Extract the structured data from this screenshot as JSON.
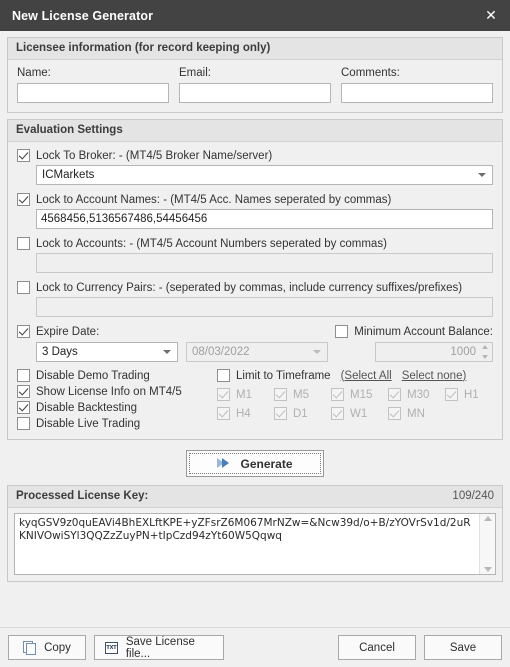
{
  "window": {
    "title": "New License Generator",
    "close_label": "✕"
  },
  "licensee": {
    "group_title": "Licensee information (for record keeping only)",
    "fields": [
      {
        "label": "Name:",
        "value": "",
        "placeholder": ""
      },
      {
        "label": "Email:",
        "value": "",
        "placeholder": ""
      },
      {
        "label": "Comments:",
        "value": "",
        "placeholder": ""
      }
    ]
  },
  "evaluation": {
    "group_title": "Evaluation Settings",
    "lock_broker": {
      "label": "Lock To Broker:  - (MT4/5 Broker Name/server)",
      "checked": true,
      "value": "ICMarkets"
    },
    "lock_account_names": {
      "label": "Lock to Account Names: - (MT4/5 Acc. Names seperated by commas)",
      "checked": true,
      "value": "4568456,5136567486,54456456"
    },
    "lock_accounts": {
      "label": "Lock to Accounts: - (MT4/5 Account Numbers seperated by commas)",
      "checked": false,
      "value": ""
    },
    "lock_currency_pairs": {
      "label": "Lock to Currency Pairs: - (seperated by commas, include currency suffixes/prefixes)",
      "checked": false,
      "value": ""
    },
    "expire_date": {
      "label": "Expire Date:",
      "checked": true,
      "duration": "3 Days",
      "date": "08/03/2022"
    },
    "minimum_balance": {
      "label": "Minimum Account Balance:",
      "checked": false,
      "value": "1000"
    },
    "toggles": [
      {
        "label": "Disable Demo Trading",
        "checked": false
      },
      {
        "label": "Show License Info on MT4/5",
        "checked": true
      },
      {
        "label": "Disable Backtesting",
        "checked": true
      },
      {
        "label": "Disable Live Trading",
        "checked": false
      }
    ],
    "timeframe": {
      "label": "Limit to Timeframe",
      "checked": false,
      "select_all": "(Select All",
      "select_none": "Select none)",
      "row1": [
        {
          "label": "M1",
          "checked": true,
          "disabled": true
        },
        {
          "label": "M5",
          "checked": true,
          "disabled": true
        },
        {
          "label": "M15",
          "checked": true,
          "disabled": true
        },
        {
          "label": "M30",
          "checked": true,
          "disabled": true
        },
        {
          "label": "H1",
          "checked": true,
          "disabled": true
        }
      ],
      "row2": [
        {
          "label": "H4",
          "checked": true,
          "disabled": true
        },
        {
          "label": "D1",
          "checked": true,
          "disabled": true
        },
        {
          "label": "W1",
          "checked": true,
          "disabled": true
        },
        {
          "label": "MN",
          "checked": true,
          "disabled": true
        }
      ]
    }
  },
  "generate": {
    "label": "Generate",
    "icon": "double-chevron-right-icon"
  },
  "license_key": {
    "title": "Processed License Key:",
    "counter": "109/240",
    "value": "kyqGSV9z0quEAVi4BhEXLftKPE+yZFsrZ6M067MrNZw=&Ncw39d/o+B/zYOVrSv1d/2uRKNIVOwiSYl3QQZzZuyPN+tIpCzd94zYt60W5Qqwq"
  },
  "footer": {
    "copy": "Copy",
    "save_license_file": "Save License file...",
    "cancel": "Cancel",
    "save": "Save",
    "txt_icon_label": "TXT"
  },
  "colors": {
    "titlebar_bg": "#434343",
    "accent_blue": "#4a7ebb",
    "group_header_bg": "#e4e4e4",
    "window_bg": "#f0f0f0"
  }
}
